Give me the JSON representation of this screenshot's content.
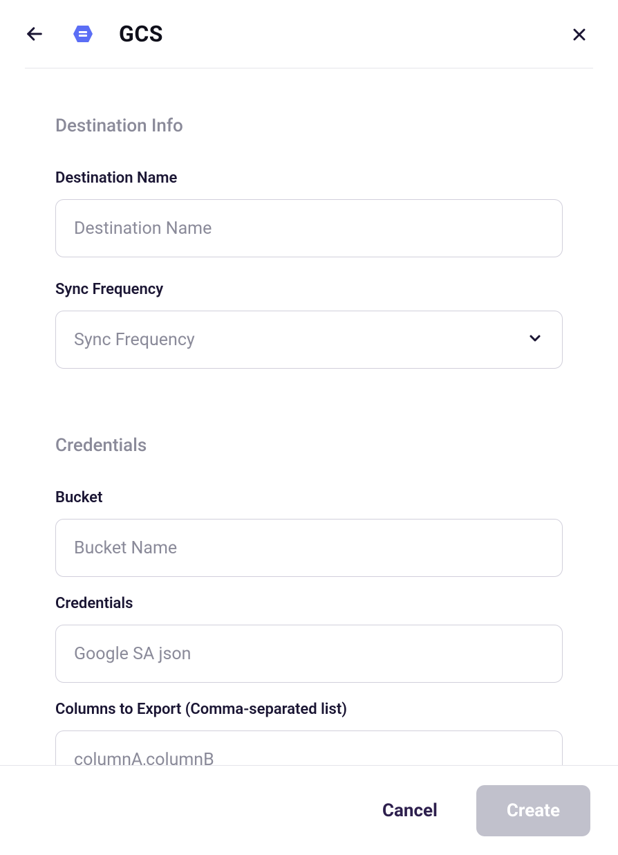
{
  "header": {
    "title": "GCS"
  },
  "sections": {
    "destination_info": {
      "title": "Destination Info",
      "fields": {
        "destination_name": {
          "label": "Destination Name",
          "placeholder": "Destination Name",
          "value": ""
        },
        "sync_frequency": {
          "label": "Sync Frequency",
          "placeholder": "Sync Frequency",
          "value": ""
        }
      }
    },
    "credentials": {
      "title": "Credentials",
      "fields": {
        "bucket": {
          "label": "Bucket",
          "placeholder": "Bucket Name",
          "value": ""
        },
        "credentials": {
          "label": "Credentials",
          "placeholder": "Google SA json",
          "value": ""
        },
        "columns_to_export": {
          "label": "Columns to Export (Comma-separated list)",
          "placeholder": "columnA,columnB",
          "value": ""
        }
      }
    }
  },
  "footer": {
    "cancel_label": "Cancel",
    "create_label": "Create"
  }
}
